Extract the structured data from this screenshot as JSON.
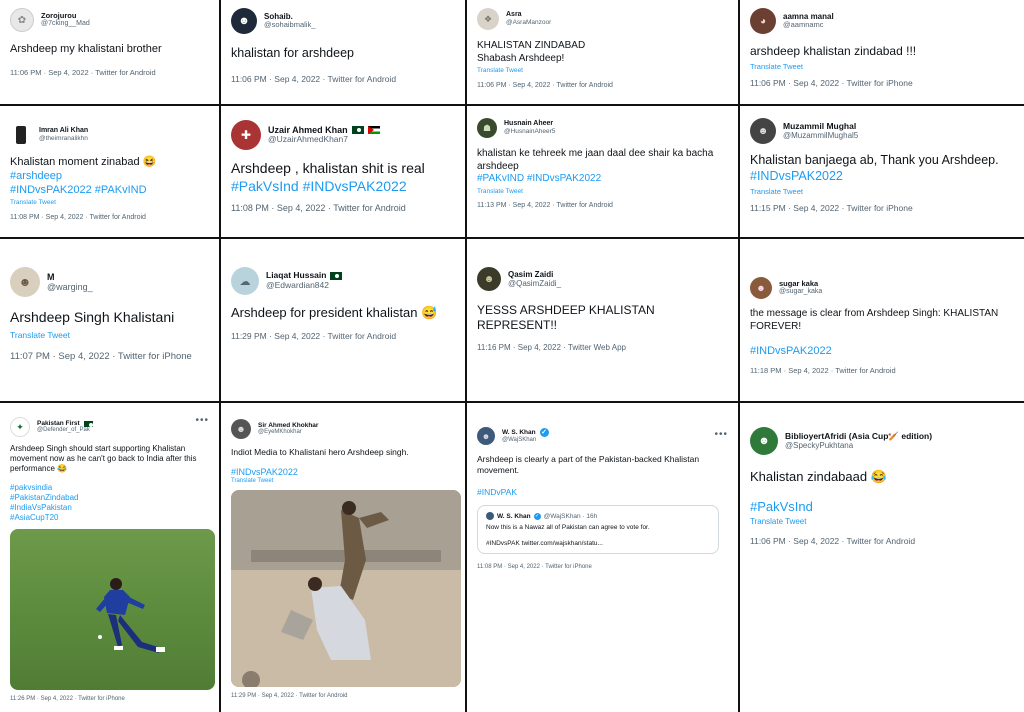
{
  "tweets": [
    {
      "name": "Zorojurou",
      "handle": "@7cking__Mad",
      "text": "Arshdeep my khalistani brother",
      "meta": "11:06 PM · Sep 4, 2022 · Twitter for Android"
    },
    {
      "name": "Sohaib.",
      "handle": "@sohaibmalik_",
      "text": "khalistan for arshdeep",
      "meta": "11:06 PM · Sep 4, 2022 · Twitter for Android"
    },
    {
      "name": "Asra",
      "handle": "@AsraManzoor",
      "text": "KHALISTAN ZINDABAD\nShabash Arshdeep!",
      "translate": "Translate Tweet",
      "meta": "11:06 PM · Sep 4, 2022 · Twitter for Android"
    },
    {
      "name": "aamna manal",
      "handle": "@aamnamc",
      "text": "arshdeep khalistan zindabad !!!",
      "translate": "Translate Tweet",
      "meta": "11:06 PM · Sep 4, 2022 · Twitter for iPhone"
    },
    {
      "name": "Imran Ali Khan",
      "handle": "@theimranalikhn",
      "text": "Khalistan moment zinabad 😆 ",
      "tags": "#arshdeep\n#INDvsPAK2022 #PAKvIND",
      "translate": "Translate Tweet",
      "meta": "11:08 PM · Sep 4, 2022 · Twitter for Android"
    },
    {
      "name": "Uzair Ahmed Khan",
      "handle": "@UzairAhmedKhan7",
      "text": "Arshdeep , khalistan shit is real",
      "tags": "#PakVsInd #INDvsPAK2022",
      "meta": "11:08 PM · Sep 4, 2022 · Twitter for Android"
    },
    {
      "name": "Husnain Aheer",
      "handle": "@HusnainAheer5",
      "text": "khalistan ke tehreek me jaan daal dee shair ka bacha arshdeep",
      "tags": "#PAKvIND #INDvsPAK2022",
      "translate": "Translate Tweet",
      "meta": "11:13 PM · Sep 4, 2022 · Twitter for Android"
    },
    {
      "name": "Muzammil Mughal",
      "handle": "@MuzammilMughal5",
      "text": "Khalistan banjaega ab, Thank you Arshdeep.",
      "tags": "#INDvsPAK2022",
      "translate": "Translate Tweet",
      "meta": "11:15 PM · Sep 4, 2022 · Twitter for iPhone"
    },
    {
      "name": "M",
      "handle": "@warging_",
      "text": "Arshdeep Singh Khalistani",
      "translate": "Translate Tweet",
      "meta": "11:07 PM · Sep 4, 2022 · Twitter for iPhone"
    },
    {
      "name": "Liaqat Hussain",
      "handle": "@Edwardian842",
      "text": "Arshdeep for president khalistan 😅",
      "meta": "11:29 PM · Sep 4, 2022 · Twitter for Android"
    },
    {
      "name": "Qasim Zaidi",
      "handle": "@QasimZaidi_",
      "text": "YESSS ARSHDEEP KHALISTAN REPRESENT!!",
      "meta": "11:16 PM · Sep 4, 2022 · Twitter Web App"
    },
    {
      "name": "sugar kaka",
      "handle": "@sugar_kaka",
      "text": "the message is clear from Arshdeep Singh: KHALISTAN FOREVER!",
      "tags": "#INDvsPAK2022",
      "meta": "11:18 PM · Sep 4, 2022 · Twitter for Android"
    },
    {
      "name": "Pakistan First",
      "handle": "@Defender_of_Pak",
      "text": "Arshdeep Singh should start supporting Khalistan movement now as he can't go back to India after this performance 😂",
      "tags": "#pakvsindia\n#PakistanZindabad\n#IndiaVsPakistan\n#AsiaCupT20",
      "meta": "11:26 PM · Sep 4, 2022 · Twitter for iPhone"
    },
    {
      "name": "Sir Ahmed Khokhar",
      "handle": "@EyeMKhokhar",
      "text": "Indiot Media to Khalistani hero Arshdeep singh.",
      "tags": "#INDvsPAK2022",
      "translate": "Translate Tweet",
      "meta": "11:29 PM · Sep 4, 2022 · Twitter for Android"
    },
    {
      "name": "W. S. Khan",
      "handle": "@WajSKhan",
      "text": "Arshdeep is clearly a part of the Pakistan-backed Khalistan movement.",
      "tags": "#INDvPAK",
      "quote": {
        "name": "W. S. Khan",
        "handle": "@WajSKhan · 16h",
        "text": "Now this is a Nawaz all of Pakistan can agree to vote for.",
        "link": "#INDvsPAK twitter.com/wajskhan/statu..."
      },
      "meta": "11:08 PM · Sep 4, 2022 · Twitter for iPhone"
    },
    {
      "name": "BiblioyertAfridi (Asia Cup🏏 edition)",
      "handle": "@SpeckyPukhtana",
      "text": "Khalistan zindabaad 😂",
      "tags": "#PakVsInd",
      "translate": "Translate Tweet",
      "meta": "11:06 PM · Sep 4, 2022 · Twitter for Android"
    }
  ],
  "icons": {
    "more": "more-dots-icon",
    "verified": "verified-badge-icon"
  },
  "colors": {
    "link": "#1d9bf0",
    "muted": "#536471",
    "separator": "#111111"
  }
}
